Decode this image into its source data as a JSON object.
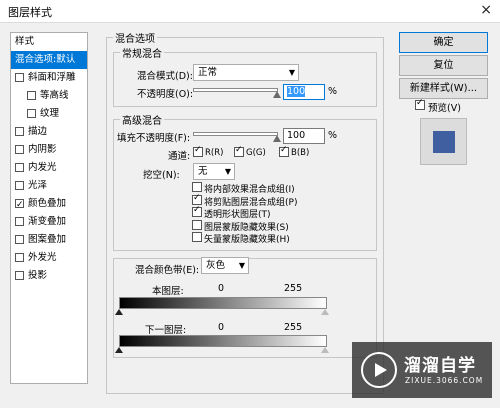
{
  "window": {
    "title": "图层样式"
  },
  "left_panel": {
    "header": "样式",
    "items": [
      {
        "label": "混合选项:默认",
        "checkbox": false,
        "checked": false,
        "selected": true,
        "sub": false
      },
      {
        "label": "斜面和浮雕",
        "checkbox": true,
        "checked": false,
        "selected": false,
        "sub": false
      },
      {
        "label": "等高线",
        "checkbox": true,
        "checked": false,
        "selected": false,
        "sub": true
      },
      {
        "label": "纹理",
        "checkbox": true,
        "checked": false,
        "selected": false,
        "sub": true
      },
      {
        "label": "描边",
        "checkbox": true,
        "checked": false,
        "selected": false,
        "sub": false
      },
      {
        "label": "内阴影",
        "checkbox": true,
        "checked": false,
        "selected": false,
        "sub": false
      },
      {
        "label": "内发光",
        "checkbox": true,
        "checked": false,
        "selected": false,
        "sub": false
      },
      {
        "label": "光泽",
        "checkbox": true,
        "checked": false,
        "selected": false,
        "sub": false
      },
      {
        "label": "颜色叠加",
        "checkbox": true,
        "checked": true,
        "selected": false,
        "sub": false
      },
      {
        "label": "渐变叠加",
        "checkbox": true,
        "checked": false,
        "selected": false,
        "sub": false
      },
      {
        "label": "图案叠加",
        "checkbox": true,
        "checked": false,
        "selected": false,
        "sub": false
      },
      {
        "label": "外发光",
        "checkbox": true,
        "checked": false,
        "selected": false,
        "sub": false
      },
      {
        "label": "投影",
        "checkbox": true,
        "checked": false,
        "selected": false,
        "sub": false
      }
    ]
  },
  "blend_options": {
    "title": "混合选项",
    "general": {
      "title": "常规混合",
      "blend_mode_label": "混合模式(D):",
      "blend_mode_value": "正常",
      "opacity_label": "不透明度(O):",
      "opacity_value": "100",
      "opacity_unit": "%"
    },
    "advanced": {
      "title": "高级混合",
      "fill_opacity_label": "填充不透明度(F):",
      "fill_opacity_value": "100",
      "fill_opacity_unit": "%",
      "channels_label": "通道:",
      "channels": [
        {
          "label": "R(R)",
          "checked": true
        },
        {
          "label": "G(G)",
          "checked": true
        },
        {
          "label": "B(B)",
          "checked": true
        }
      ],
      "knockout_label": "挖空(N):",
      "knockout_value": "无",
      "options": [
        {
          "label": "将内部效果混合成组(I)",
          "checked": false
        },
        {
          "label": "将剪贴图层混合成组(P)",
          "checked": true
        },
        {
          "label": "透明形状图层(T)",
          "checked": true
        },
        {
          "label": "图层蒙版隐藏效果(S)",
          "checked": false
        },
        {
          "label": "矢量蒙版隐藏效果(H)",
          "checked": false
        }
      ]
    },
    "blend_if": {
      "label": "混合颜色带(E):",
      "value": "灰色",
      "this_layer_label": "本图层:",
      "this_layer_min": "0",
      "this_layer_max": "255",
      "underlying_label": "下一图层:",
      "underlying_min": "0",
      "underlying_max": "255"
    }
  },
  "buttons": {
    "ok": "确定",
    "reset": "复位",
    "new_style": "新建样式(W)...",
    "preview_label": "预览(V)",
    "preview_checked": true
  },
  "preview": {
    "swatch_color": "#3f5fa0",
    "frame_color": "#dcdcdc"
  },
  "watermark": {
    "brand": "溜溜自学",
    "url": "ZIXUE.3066.COM"
  }
}
